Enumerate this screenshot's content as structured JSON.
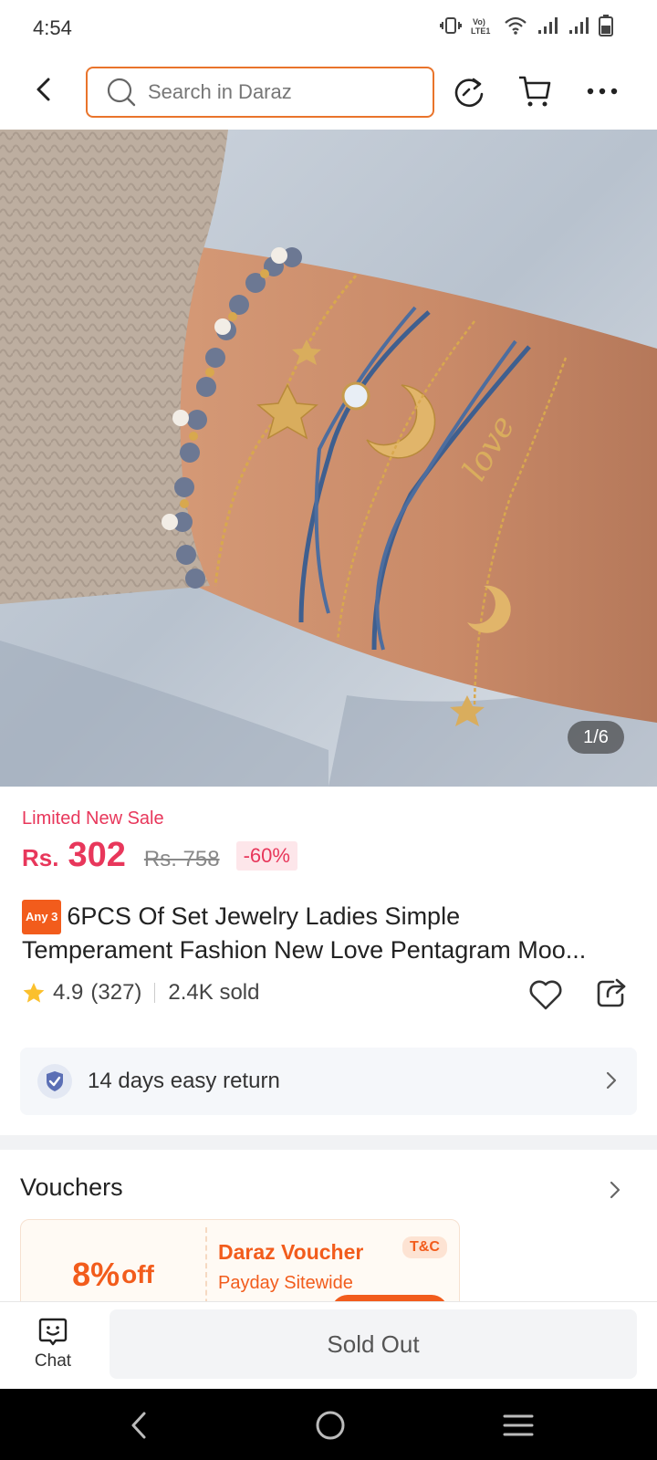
{
  "status_bar": {
    "time": "4:54"
  },
  "search": {
    "placeholder": "Search in Daraz"
  },
  "gallery": {
    "counter": "1/6"
  },
  "product": {
    "sale_label": "Limited New Sale",
    "currency": "Rs.",
    "price": "302",
    "old_price": "Rs. 758",
    "discount": "-60%",
    "badge": "Any 3",
    "title_line1": "6PCS Of Set Jewelry Ladies Simple",
    "title_line2": "Temperament Fashion New Love Pentagram Moo...",
    "rating": "4.9",
    "rating_count": "(327)",
    "sold": "2.4K sold"
  },
  "return_policy": {
    "label": "14 days easy return"
  },
  "vouchers": {
    "title": "Vouchers",
    "items": [
      {
        "percent": "8%",
        "off": "off",
        "name": "Daraz Voucher",
        "subtitle": "Payday Sitewide",
        "tc": "T&C"
      }
    ]
  },
  "bottom": {
    "chat_label": "Chat",
    "action_label": "Sold Out"
  },
  "colors": {
    "accent": "#f25c1c",
    "price": "#e8375b",
    "search_border": "#e9742b"
  }
}
